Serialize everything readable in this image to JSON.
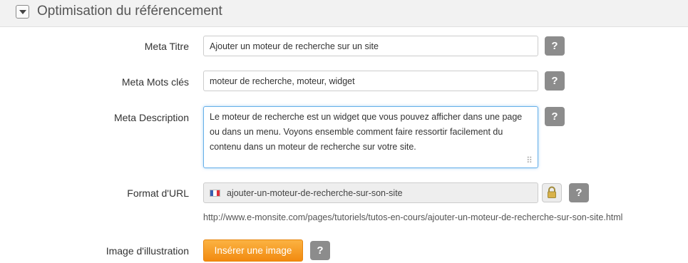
{
  "section": {
    "title": "Optimisation du référencement"
  },
  "fields": {
    "meta_title": {
      "label": "Meta Titre",
      "value": "Ajouter un moteur de recherche sur un site"
    },
    "meta_keywords": {
      "label": "Meta Mots clés",
      "value": "moteur de recherche, moteur, widget"
    },
    "meta_description": {
      "label": "Meta Description",
      "value": "Le moteur de recherche est un widget que vous pouvez afficher dans une page ou dans un menu. Voyons ensemble comment faire ressortir facilement du contenu dans un moteur de recherche sur votre site."
    },
    "url_format": {
      "label": "Format d'URL",
      "slug": "ajouter-un-moteur-de-recherche-sur-son-site",
      "full_url": "http://www.e-monsite.com/pages/tutoriels/tutos-en-cours/ajouter-un-moteur-de-recherche-sur-son-site.html"
    },
    "image": {
      "label": "Image d'illustration",
      "button_label": "Insérer une image"
    }
  },
  "help_label": "?",
  "colors": {
    "accent_orange": "#f5a02a",
    "help_gray": "#8c8c8c",
    "focus_blue": "#66afe9"
  },
  "icons": {
    "collapse": "triangle-down-icon",
    "flag": "french-flag-icon",
    "lock": "lock-icon",
    "resize": "resize-grip-icon"
  }
}
